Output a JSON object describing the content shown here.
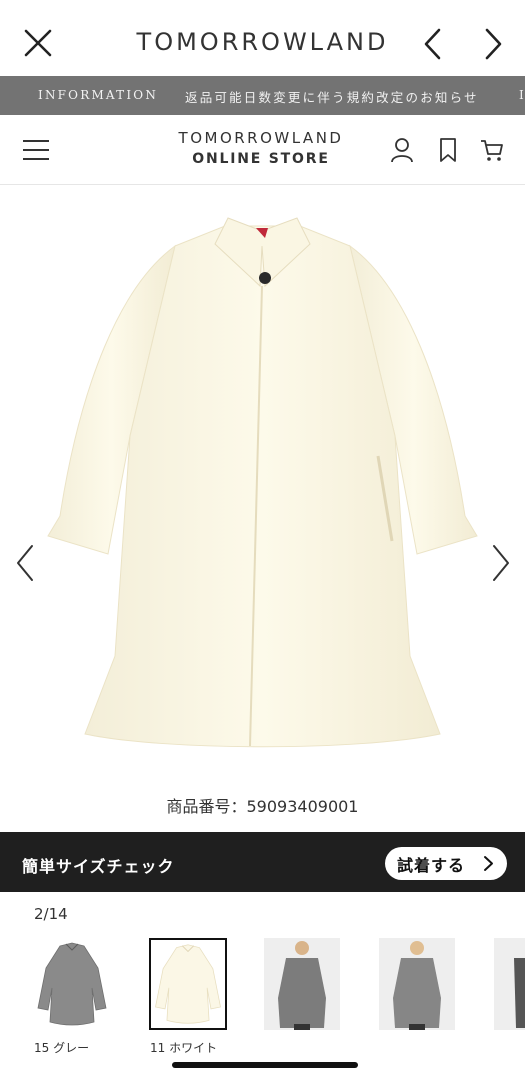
{
  "browser": {
    "title": "TOMORROWLAND",
    "close_icon": "close-icon",
    "back_icon": "chevron-left-icon",
    "forward_icon": "chevron-right-icon"
  },
  "info_banner": {
    "label": "INFORMATION",
    "message": "返品可能日数変更に伴う規約改定のお知らせ",
    "next_label": "I"
  },
  "store_header": {
    "brand_line1": "TOMORROWLAND",
    "brand_line2": "ONLINE STORE",
    "icons": [
      "menu-icon",
      "user-icon",
      "bookmark-icon",
      "cart-icon"
    ]
  },
  "product": {
    "number_label": "商品番号：59093409001",
    "image_icons": [
      "chevron-left-icon",
      "chevron-right-icon"
    ]
  },
  "size_check": {
    "label": "簡単サイズチェック",
    "button_label": "試着する"
  },
  "gallery": {
    "counter": "2/14"
  },
  "color_options": [
    {
      "label": "15 グレー",
      "selected": false
    },
    {
      "label": "11 ホワイト",
      "selected": true
    }
  ],
  "colors": {
    "info_banner_bg": "#737373",
    "size_bar_bg": "#1f1f1f",
    "coat_white": "#fbf7e6",
    "coat_grey": "#8a8a8a"
  }
}
